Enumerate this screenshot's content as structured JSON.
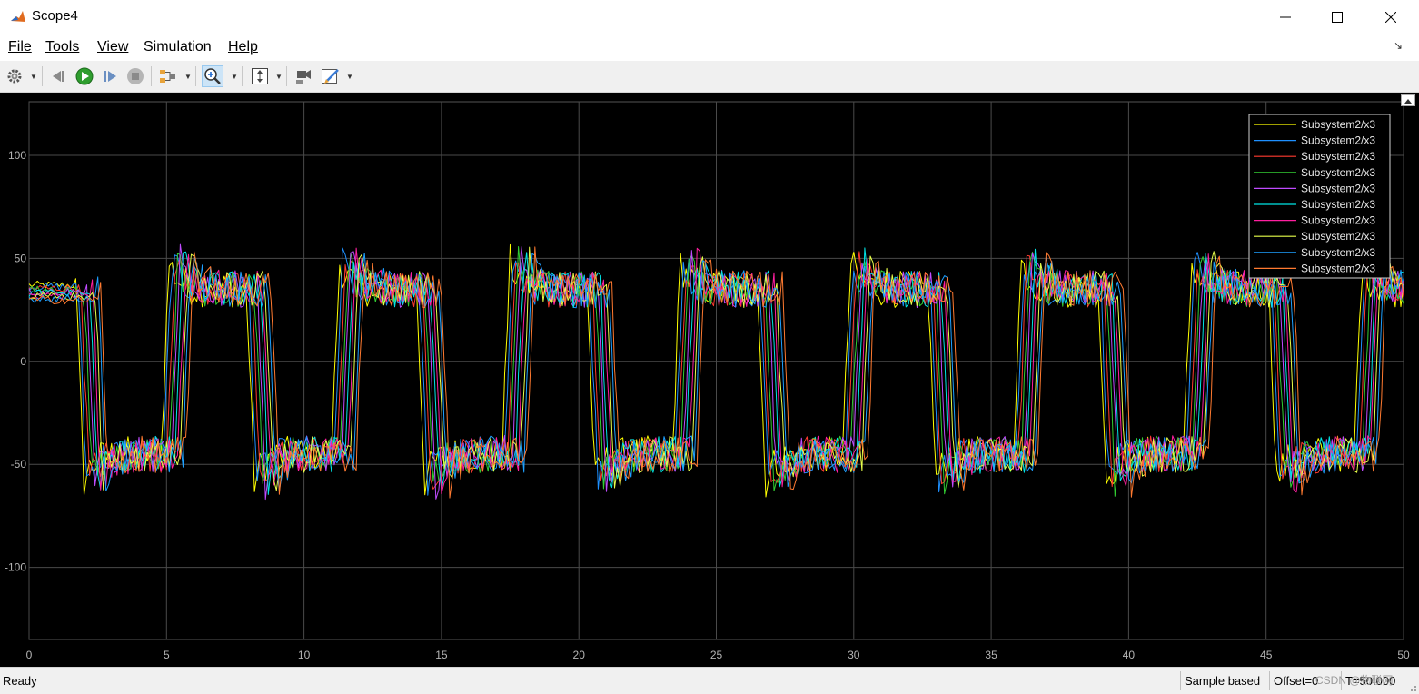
{
  "window": {
    "title": "Scope4"
  },
  "menu": {
    "file": "File",
    "tools": "Tools",
    "view": "View",
    "simulation": "Simulation",
    "help": "Help"
  },
  "toolbar": {
    "buttons": [
      "gear-icon",
      "step-back-icon",
      "run-icon",
      "step-forward-icon",
      "stop-icon",
      "signal-select-icon",
      "zoom-in-icon",
      "scale-axes-icon",
      "highlight-icon",
      "style-icon"
    ],
    "active": "zoom-in-icon"
  },
  "status": {
    "ready": "Ready",
    "sample": "Sample based",
    "offset": "Offset=0",
    "time": "T=50.000",
    "watermark": "CSDN @物联网"
  },
  "chart_data": {
    "type": "line",
    "xlim": [
      0,
      50
    ],
    "ylim": [
      -135,
      126
    ],
    "x_ticks": [
      "0",
      "5",
      "10",
      "15",
      "20",
      "25",
      "30",
      "35",
      "40",
      "45",
      "50"
    ],
    "y_ticks": [
      "100",
      "50",
      "0",
      "-50",
      "-100"
    ],
    "grid": true,
    "legend_position": "top-right",
    "background": "#000000",
    "series": [
      {
        "name": "Subsystem2/x3",
        "color": "#ffff00",
        "phase": 0.0,
        "values": []
      },
      {
        "name": "Subsystem2/x3",
        "color": "#1e90ff",
        "phase": 0.1,
        "values": []
      },
      {
        "name": "Subsystem2/x3",
        "color": "#ff3b30",
        "phase": 0.2,
        "values": []
      },
      {
        "name": "Subsystem2/x3",
        "color": "#32cd32",
        "phase": 0.3,
        "values": []
      },
      {
        "name": "Subsystem2/x3",
        "color": "#c04bff",
        "phase": 0.4,
        "values": []
      },
      {
        "name": "Subsystem2/x3",
        "color": "#00e5e5",
        "phase": 0.5,
        "values": []
      },
      {
        "name": "Subsystem2/x3",
        "color": "#ff1fa0",
        "phase": 0.6,
        "values": []
      },
      {
        "name": "Subsystem2/x3",
        "color": "#e8ff4a",
        "phase": 0.7,
        "values": []
      },
      {
        "name": "Subsystem2/x3",
        "color": "#1ea0ff",
        "phase": 0.8,
        "values": []
      },
      {
        "name": "Subsystem2/x3",
        "color": "#ff7a30",
        "phase": 0.9,
        "values": []
      }
    ],
    "shape": {
      "initial_level": 37,
      "high_level": 35,
      "low_level": -45,
      "first_fall": 1.7,
      "half_period": 3.1,
      "transition": 0.25,
      "noise": 9,
      "initial_noise": 2,
      "overshoot": 15,
      "sample_step": 0.1
    }
  }
}
